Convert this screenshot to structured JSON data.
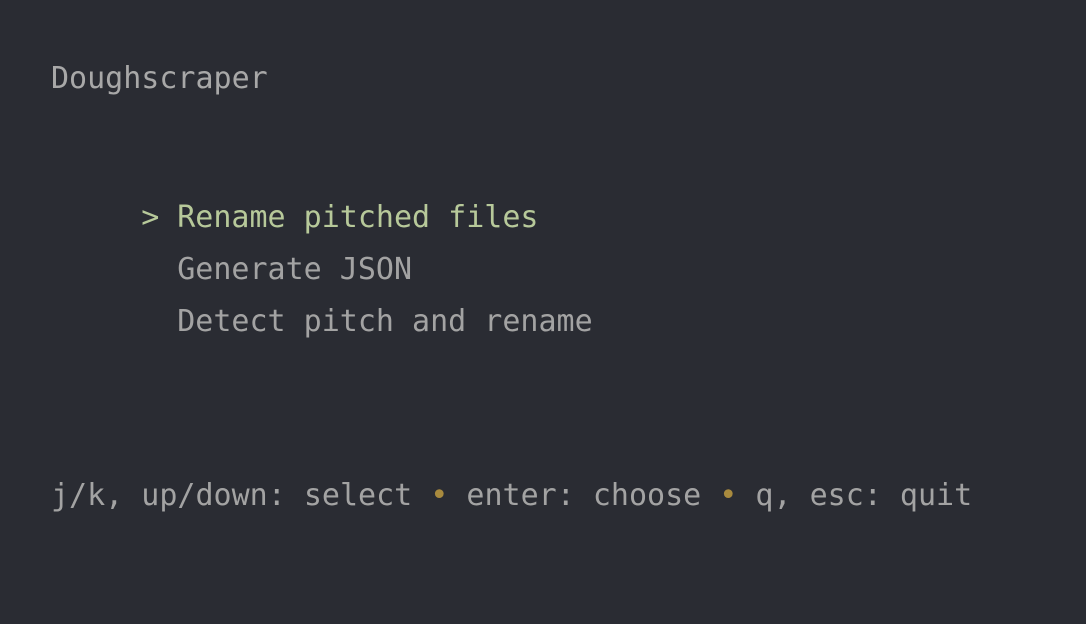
{
  "app": {
    "title": "Doughscraper"
  },
  "menu": {
    "cursor_glyph": ">",
    "selected_index": 0,
    "items": [
      {
        "label": "Rename pitched files"
      },
      {
        "label": "Generate JSON"
      },
      {
        "label": "Detect pitch and rename"
      }
    ]
  },
  "help": {
    "select": "j/k, up/down: select",
    "choose": "enter: choose",
    "quit": "q, esc: quit",
    "separator": "•"
  },
  "colors": {
    "background": "#2a2c33",
    "text": "#a3a3a3",
    "selected": "#b7c99a",
    "separator": "#a88a3e"
  }
}
